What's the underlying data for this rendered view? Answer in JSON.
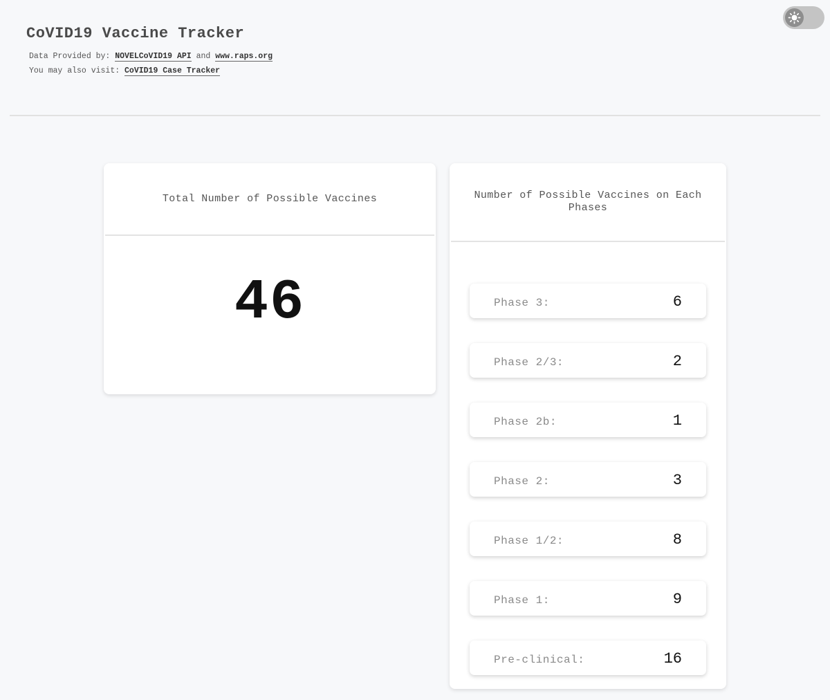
{
  "header": {
    "title": "CoVID19 Vaccine Tracker",
    "data_prefix": "Data Provided by:",
    "api_link": "NOVELCoVID19 API",
    "and_text": "and",
    "raps_link": "www.raps.org",
    "visit_prefix": "You may also visit:",
    "case_tracker_link": "CoVID19 Case Tracker"
  },
  "theme_toggle": {
    "icon": "sun-icon",
    "state": "off"
  },
  "total_card": {
    "title": "Total Number of Possible Vaccines",
    "value": "46"
  },
  "phases_card": {
    "title": "Number of Possible Vaccines on Each Phases",
    "items": [
      {
        "label": "Phase 3:",
        "value": "6"
      },
      {
        "label": "Phase 2/3:",
        "value": "2"
      },
      {
        "label": "Phase 2b:",
        "value": "1"
      },
      {
        "label": "Phase 2:",
        "value": "3"
      },
      {
        "label": "Phase 1/2:",
        "value": "8"
      },
      {
        "label": "Phase 1:",
        "value": "9"
      },
      {
        "label": "Pre-clinical:",
        "value": "16"
      }
    ]
  }
}
